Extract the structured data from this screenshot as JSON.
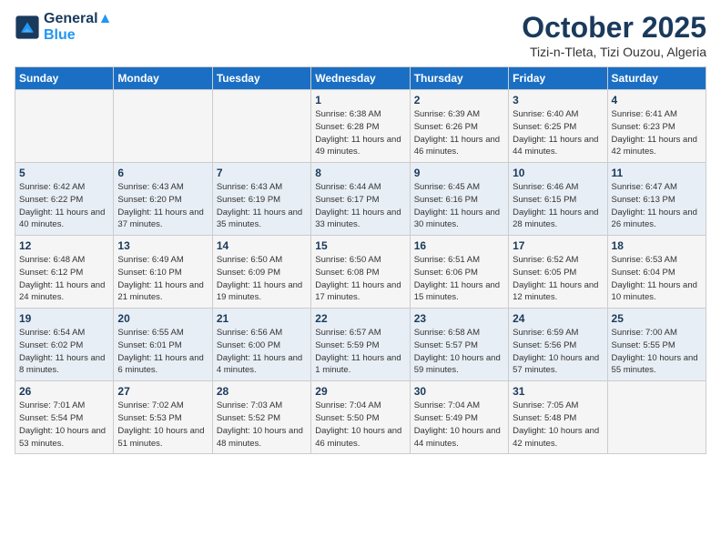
{
  "header": {
    "logo_line1": "General",
    "logo_line2": "Blue",
    "month": "October 2025",
    "location": "Tizi-n-Tleta, Tizi Ouzou, Algeria"
  },
  "days_of_week": [
    "Sunday",
    "Monday",
    "Tuesday",
    "Wednesday",
    "Thursday",
    "Friday",
    "Saturday"
  ],
  "weeks": [
    [
      {
        "day": "",
        "sunrise": "",
        "sunset": "",
        "daylight": ""
      },
      {
        "day": "",
        "sunrise": "",
        "sunset": "",
        "daylight": ""
      },
      {
        "day": "",
        "sunrise": "",
        "sunset": "",
        "daylight": ""
      },
      {
        "day": "1",
        "sunrise": "Sunrise: 6:38 AM",
        "sunset": "Sunset: 6:28 PM",
        "daylight": "Daylight: 11 hours and 49 minutes."
      },
      {
        "day": "2",
        "sunrise": "Sunrise: 6:39 AM",
        "sunset": "Sunset: 6:26 PM",
        "daylight": "Daylight: 11 hours and 46 minutes."
      },
      {
        "day": "3",
        "sunrise": "Sunrise: 6:40 AM",
        "sunset": "Sunset: 6:25 PM",
        "daylight": "Daylight: 11 hours and 44 minutes."
      },
      {
        "day": "4",
        "sunrise": "Sunrise: 6:41 AM",
        "sunset": "Sunset: 6:23 PM",
        "daylight": "Daylight: 11 hours and 42 minutes."
      }
    ],
    [
      {
        "day": "5",
        "sunrise": "Sunrise: 6:42 AM",
        "sunset": "Sunset: 6:22 PM",
        "daylight": "Daylight: 11 hours and 40 minutes."
      },
      {
        "day": "6",
        "sunrise": "Sunrise: 6:43 AM",
        "sunset": "Sunset: 6:20 PM",
        "daylight": "Daylight: 11 hours and 37 minutes."
      },
      {
        "day": "7",
        "sunrise": "Sunrise: 6:43 AM",
        "sunset": "Sunset: 6:19 PM",
        "daylight": "Daylight: 11 hours and 35 minutes."
      },
      {
        "day": "8",
        "sunrise": "Sunrise: 6:44 AM",
        "sunset": "Sunset: 6:17 PM",
        "daylight": "Daylight: 11 hours and 33 minutes."
      },
      {
        "day": "9",
        "sunrise": "Sunrise: 6:45 AM",
        "sunset": "Sunset: 6:16 PM",
        "daylight": "Daylight: 11 hours and 30 minutes."
      },
      {
        "day": "10",
        "sunrise": "Sunrise: 6:46 AM",
        "sunset": "Sunset: 6:15 PM",
        "daylight": "Daylight: 11 hours and 28 minutes."
      },
      {
        "day": "11",
        "sunrise": "Sunrise: 6:47 AM",
        "sunset": "Sunset: 6:13 PM",
        "daylight": "Daylight: 11 hours and 26 minutes."
      }
    ],
    [
      {
        "day": "12",
        "sunrise": "Sunrise: 6:48 AM",
        "sunset": "Sunset: 6:12 PM",
        "daylight": "Daylight: 11 hours and 24 minutes."
      },
      {
        "day": "13",
        "sunrise": "Sunrise: 6:49 AM",
        "sunset": "Sunset: 6:10 PM",
        "daylight": "Daylight: 11 hours and 21 minutes."
      },
      {
        "day": "14",
        "sunrise": "Sunrise: 6:50 AM",
        "sunset": "Sunset: 6:09 PM",
        "daylight": "Daylight: 11 hours and 19 minutes."
      },
      {
        "day": "15",
        "sunrise": "Sunrise: 6:50 AM",
        "sunset": "Sunset: 6:08 PM",
        "daylight": "Daylight: 11 hours and 17 minutes."
      },
      {
        "day": "16",
        "sunrise": "Sunrise: 6:51 AM",
        "sunset": "Sunset: 6:06 PM",
        "daylight": "Daylight: 11 hours and 15 minutes."
      },
      {
        "day": "17",
        "sunrise": "Sunrise: 6:52 AM",
        "sunset": "Sunset: 6:05 PM",
        "daylight": "Daylight: 11 hours and 12 minutes."
      },
      {
        "day": "18",
        "sunrise": "Sunrise: 6:53 AM",
        "sunset": "Sunset: 6:04 PM",
        "daylight": "Daylight: 11 hours and 10 minutes."
      }
    ],
    [
      {
        "day": "19",
        "sunrise": "Sunrise: 6:54 AM",
        "sunset": "Sunset: 6:02 PM",
        "daylight": "Daylight: 11 hours and 8 minutes."
      },
      {
        "day": "20",
        "sunrise": "Sunrise: 6:55 AM",
        "sunset": "Sunset: 6:01 PM",
        "daylight": "Daylight: 11 hours and 6 minutes."
      },
      {
        "day": "21",
        "sunrise": "Sunrise: 6:56 AM",
        "sunset": "Sunset: 6:00 PM",
        "daylight": "Daylight: 11 hours and 4 minutes."
      },
      {
        "day": "22",
        "sunrise": "Sunrise: 6:57 AM",
        "sunset": "Sunset: 5:59 PM",
        "daylight": "Daylight: 11 hours and 1 minute."
      },
      {
        "day": "23",
        "sunrise": "Sunrise: 6:58 AM",
        "sunset": "Sunset: 5:57 PM",
        "daylight": "Daylight: 10 hours and 59 minutes."
      },
      {
        "day": "24",
        "sunrise": "Sunrise: 6:59 AM",
        "sunset": "Sunset: 5:56 PM",
        "daylight": "Daylight: 10 hours and 57 minutes."
      },
      {
        "day": "25",
        "sunrise": "Sunrise: 7:00 AM",
        "sunset": "Sunset: 5:55 PM",
        "daylight": "Daylight: 10 hours and 55 minutes."
      }
    ],
    [
      {
        "day": "26",
        "sunrise": "Sunrise: 7:01 AM",
        "sunset": "Sunset: 5:54 PM",
        "daylight": "Daylight: 10 hours and 53 minutes."
      },
      {
        "day": "27",
        "sunrise": "Sunrise: 7:02 AM",
        "sunset": "Sunset: 5:53 PM",
        "daylight": "Daylight: 10 hours and 51 minutes."
      },
      {
        "day": "28",
        "sunrise": "Sunrise: 7:03 AM",
        "sunset": "Sunset: 5:52 PM",
        "daylight": "Daylight: 10 hours and 48 minutes."
      },
      {
        "day": "29",
        "sunrise": "Sunrise: 7:04 AM",
        "sunset": "Sunset: 5:50 PM",
        "daylight": "Daylight: 10 hours and 46 minutes."
      },
      {
        "day": "30",
        "sunrise": "Sunrise: 7:04 AM",
        "sunset": "Sunset: 5:49 PM",
        "daylight": "Daylight: 10 hours and 44 minutes."
      },
      {
        "day": "31",
        "sunrise": "Sunrise: 7:05 AM",
        "sunset": "Sunset: 5:48 PM",
        "daylight": "Daylight: 10 hours and 42 minutes."
      },
      {
        "day": "",
        "sunrise": "",
        "sunset": "",
        "daylight": ""
      }
    ]
  ]
}
